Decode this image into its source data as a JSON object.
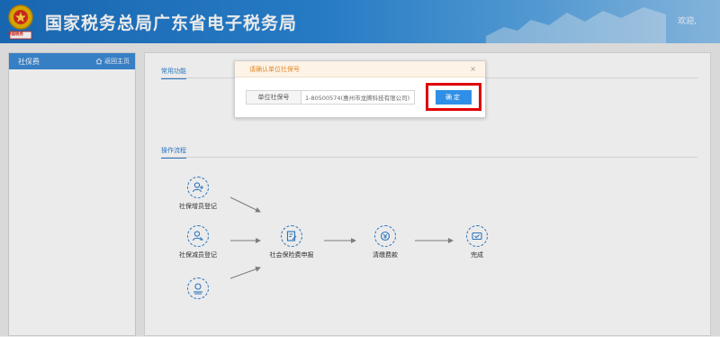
{
  "header": {
    "title": "国家税务总局广东省电子税务局",
    "welcome": "欢迎,",
    "emblem_label": "中国税务"
  },
  "sidebar": {
    "title": "社保费",
    "back_label": "返回主页"
  },
  "main": {
    "common_functions_title": "常用功能",
    "process_title": "操作流程",
    "flow": {
      "nodes": [
        {
          "label": "社保增员登记",
          "icon": "person-add-icon"
        },
        {
          "label": "社保减员登记",
          "icon": "person-remove-icon"
        },
        {
          "label": "",
          "icon": "hand-coin-icon"
        },
        {
          "label": "社会保险费申报",
          "icon": "document-edit-icon"
        },
        {
          "label": "清缴费款",
          "icon": "coin-icon"
        },
        {
          "label": "完成",
          "icon": "ticket-done-icon"
        }
      ]
    }
  },
  "dialog": {
    "title": "请确认单位社保号",
    "close_label": "×",
    "field_label": "单位社保号",
    "field_value": "1-80500574(惠州市龙腾科技有限公司)",
    "confirm_label": "确定"
  },
  "colors": {
    "header_blue": "#1c6fbf",
    "accent": "#2f7fce",
    "highlight_red": "#e00000",
    "dialog_title": "#e08a2b"
  }
}
